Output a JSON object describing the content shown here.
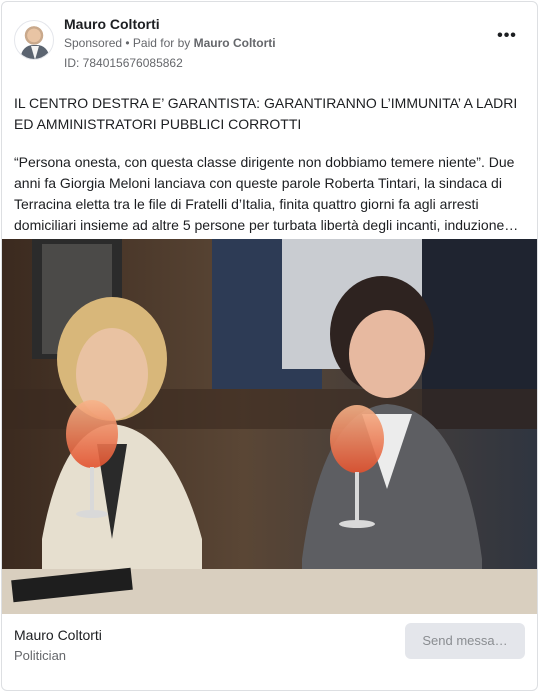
{
  "post": {
    "page_name": "Mauro Coltorti",
    "sponsored_label": "Sponsored",
    "paid_for_prefix": " • Paid for by ",
    "paid_for_by": "Mauro Coltorti",
    "ad_id": "ID: 784015676085862",
    "more_icon": "more-horizontal-icon",
    "more_label": "•••",
    "headline": "IL CENTRO DESTRA E’ GARANTISTA: GARANTIRANNO L’IMMUNITA’ A LADRI ED AMMINISTRATORI PUBBLICI CORROTTI",
    "excerpt": "“Persona onesta, con questa classe dirigente non dobbiamo temere niente”. Due anni fa Giorgia Meloni lanciava con queste parole Roberta Tintari, la sindaca di Terracina eletta tra le file di Fratelli d’Italia, finita quattro giorni fa agli arresti domiciliari insieme ad altre 5 persone per turbata libertà degli incanti, induzione…"
  },
  "footer": {
    "page_name": "Mauro Coltorti",
    "category": "Politician",
    "send_button": "Send messa…"
  },
  "colors": {
    "text_primary": "#1c1e21",
    "text_secondary": "#65676b",
    "button_bg": "#e4e6eb",
    "button_text": "#8a8d91",
    "border": "#dddfe2"
  }
}
